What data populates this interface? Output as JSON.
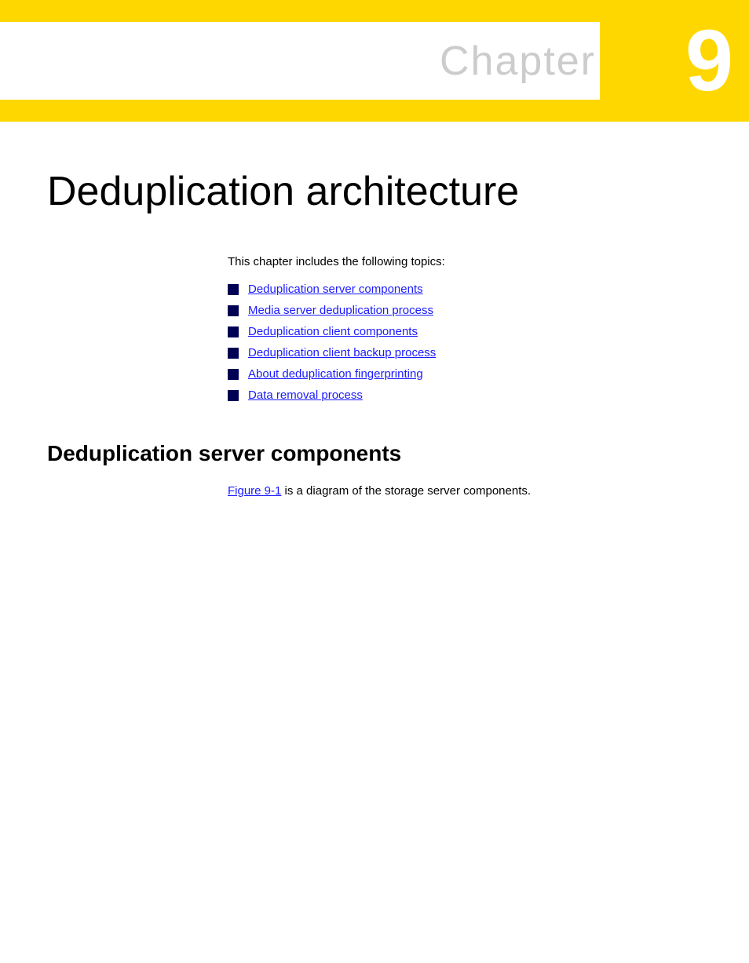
{
  "header": {
    "chapter_label": "Chapter",
    "chapter_number": "9",
    "yellow_color": "#FFD700"
  },
  "page": {
    "title": "Deduplication architecture",
    "intro_text": "This chapter includes the following topics:",
    "toc_items": [
      {
        "label": "Deduplication server components",
        "href": "#deduplication-server-components"
      },
      {
        "label": "Media server deduplication process",
        "href": "#media-server-deduplication-process"
      },
      {
        "label": "Deduplication client components",
        "href": "#deduplication-client-components"
      },
      {
        "label": "Deduplication client backup process",
        "href": "#deduplication-client-backup-process"
      },
      {
        "label": "About deduplication fingerprinting",
        "href": "#about-deduplication-fingerprinting"
      },
      {
        "label": "Data removal process",
        "href": "#data-removal-process"
      }
    ],
    "section1": {
      "heading": "Deduplication server components",
      "body_prefix": "",
      "figure_link": "Figure 9-1",
      "body_suffix": " is a diagram of the storage server components."
    }
  }
}
